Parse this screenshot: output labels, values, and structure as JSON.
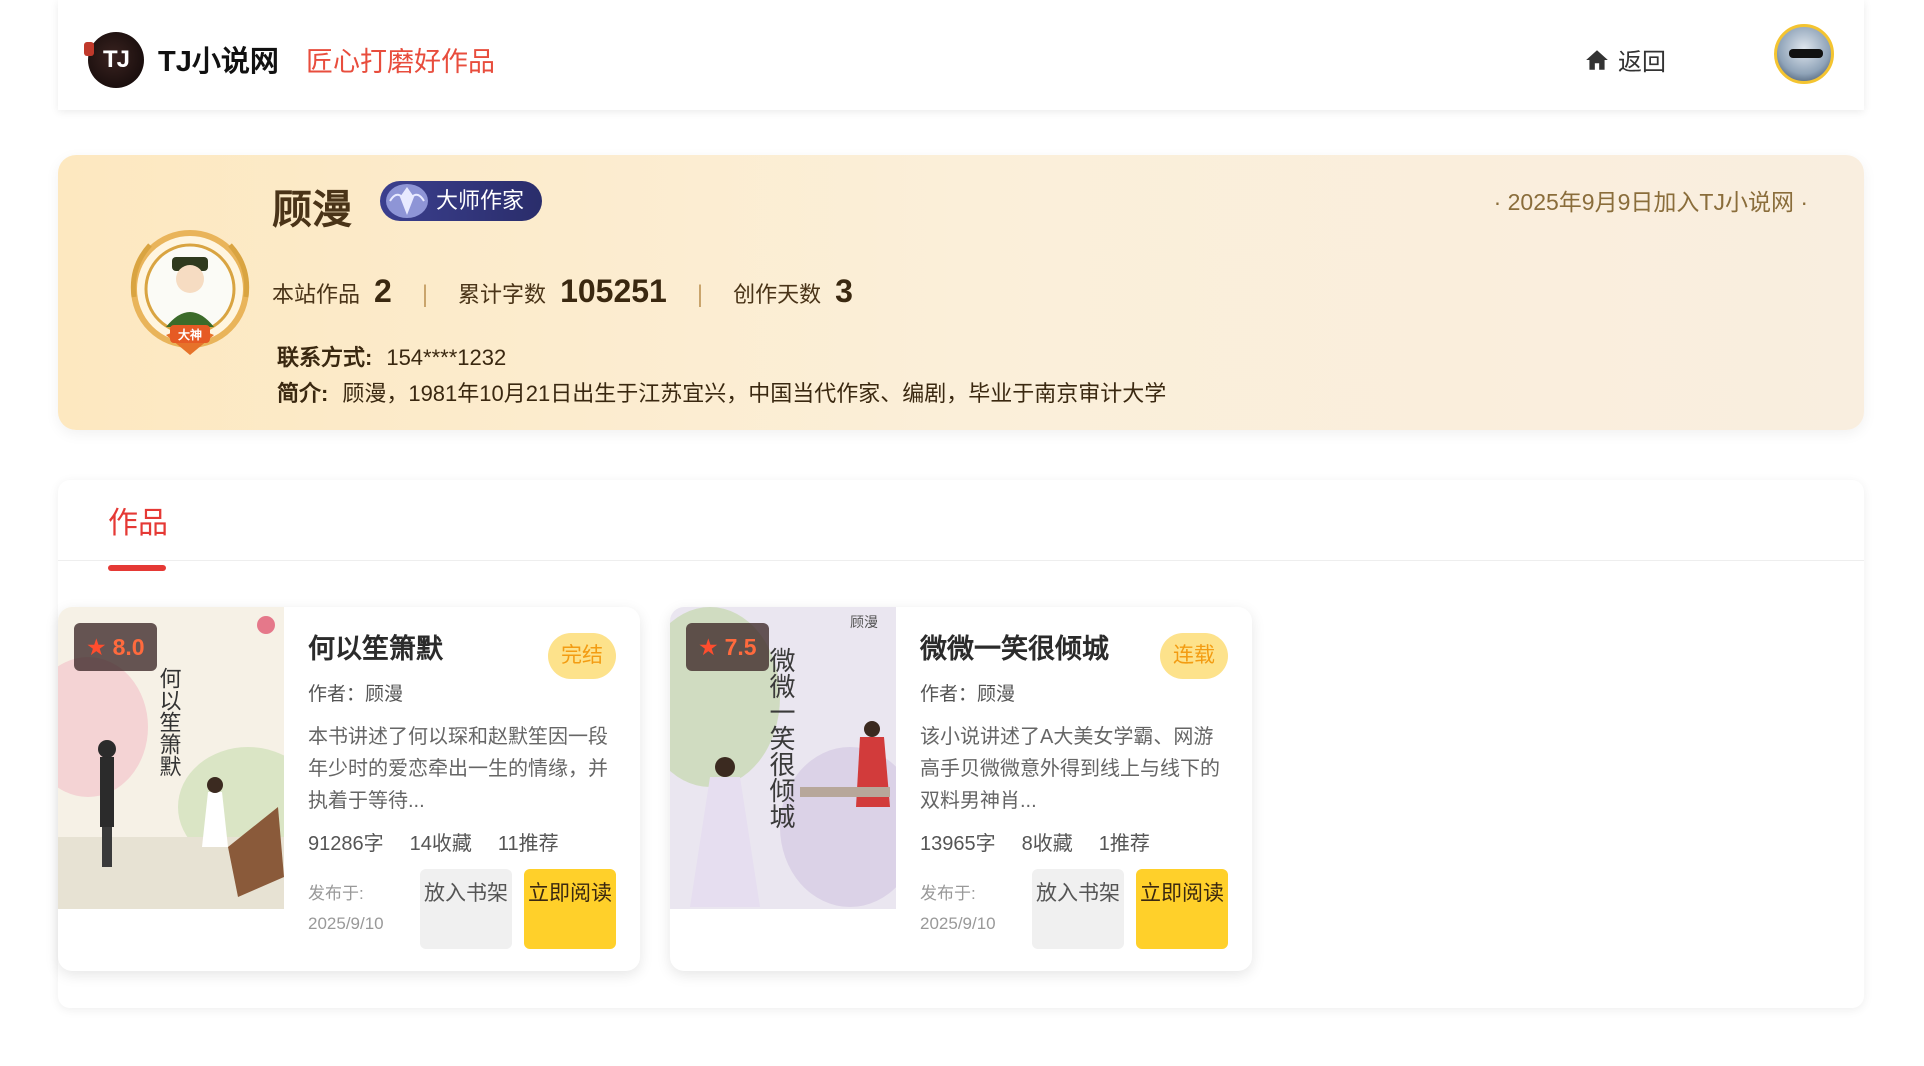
{
  "header": {
    "logo_text": "TJ",
    "site_name": "TJ小说网",
    "slogan": "匠心打磨好作品",
    "back_label": "返回"
  },
  "profile": {
    "name": "顾漫",
    "level": "大师作家",
    "medal_label": "大神",
    "join_date": "· 2025年9月9日加入TJ小说网 ·",
    "stats": [
      {
        "label": "本站作品",
        "value": "2"
      },
      {
        "label": "累计字数",
        "value": "105251"
      },
      {
        "label": "创作天数",
        "value": "3"
      }
    ],
    "stat_separator": "|",
    "contact_label": "联系方式:",
    "contact_value": "154****1232",
    "intro_label": "简介:",
    "intro_value": "顾漫，1981年10月21日出生于江苏宜兴，中国当代作家、编剧，毕业于南京审计大学"
  },
  "works": {
    "tab_label": "作品",
    "books": [
      {
        "rating_star": "★",
        "rating": "8.0",
        "title": "何以笙箫默",
        "status": "完结",
        "author": "作者：顾漫",
        "description": "本书讲述了何以琛和赵默笙因一段年少时的爱恋牵出一生的情缘，并执着于等待...",
        "words": "91286字",
        "favorites": "14收藏",
        "recommends": "11推荐",
        "published_label": "发布于:",
        "published_date": "2025/9/10",
        "shelf_button": "放入书架",
        "read_button": "立即阅读"
      },
      {
        "rating_star": "★",
        "rating": "7.5",
        "title": "微微一笑很倾城",
        "status": "连载",
        "author": "作者：顾漫",
        "description": "该小说讲述了A大美女学霸、网游高手贝微微意外得到线上与线下的双料男神肖...",
        "words": "13965字",
        "favorites": "8收藏",
        "recommends": "1推荐",
        "published_label": "发布于:",
        "published_date": "2025/9/10",
        "shelf_button": "放入书架",
        "read_button": "立即阅读"
      }
    ]
  },
  "colors": {
    "accent_red": "#e53935",
    "slogan_red": "#e84d3d",
    "read_button_yellow": "#ffd02a",
    "status_badge_bg": "#fde28b",
    "status_badge_text": "#f39c12",
    "profile_gradient_start": "#fde8c0",
    "level_badge_blue": "#3b3f8e"
  },
  "icons": {
    "back": "home-icon",
    "rating": "star-icon",
    "level": "master-author-badge-icon",
    "medal": "author-medal-icon"
  }
}
